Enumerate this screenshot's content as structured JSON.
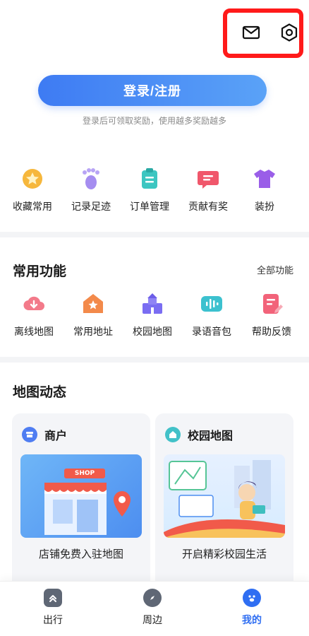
{
  "header": {
    "icons": [
      "mail-icon",
      "settings-icon"
    ],
    "highlight_color": "#ff1a1a"
  },
  "login": {
    "button_label": "登录/注册",
    "tip": "登录后可领取奖励，使用越多奖励越多",
    "accent": "#3e7bf3"
  },
  "quick": [
    {
      "label": "收藏常用",
      "icon": "star-icon"
    },
    {
      "label": "记录足迹",
      "icon": "footprint-icon"
    },
    {
      "label": "订单管理",
      "icon": "clipboard-icon"
    },
    {
      "label": "贡献有奖",
      "icon": "message-icon"
    },
    {
      "label": "装扮",
      "icon": "tshirt-icon"
    }
  ],
  "common": {
    "title": "常用功能",
    "more": "全部功能",
    "items": [
      {
        "label": "离线地图",
        "icon": "cloud-download-icon"
      },
      {
        "label": "常用地址",
        "icon": "home-star-icon"
      },
      {
        "label": "校园地图",
        "icon": "campus-icon"
      },
      {
        "label": "录语音包",
        "icon": "voice-wave-icon"
      },
      {
        "label": "帮助反馈",
        "icon": "feedback-icon"
      }
    ]
  },
  "dynamic": {
    "title": "地图动态",
    "cards": [
      {
        "title": "商户",
        "caption": "店铺免费入驻地图",
        "icon": "shop-icon",
        "sign": "SHOP"
      },
      {
        "title": "校园地图",
        "caption": "开启精彩校园生活",
        "icon": "house-icon"
      }
    ]
  },
  "nav": [
    {
      "label": "出行",
      "icon": "route-icon"
    },
    {
      "label": "周边",
      "icon": "compass-icon"
    },
    {
      "label": "我的",
      "icon": "paw-icon",
      "active": true
    }
  ]
}
